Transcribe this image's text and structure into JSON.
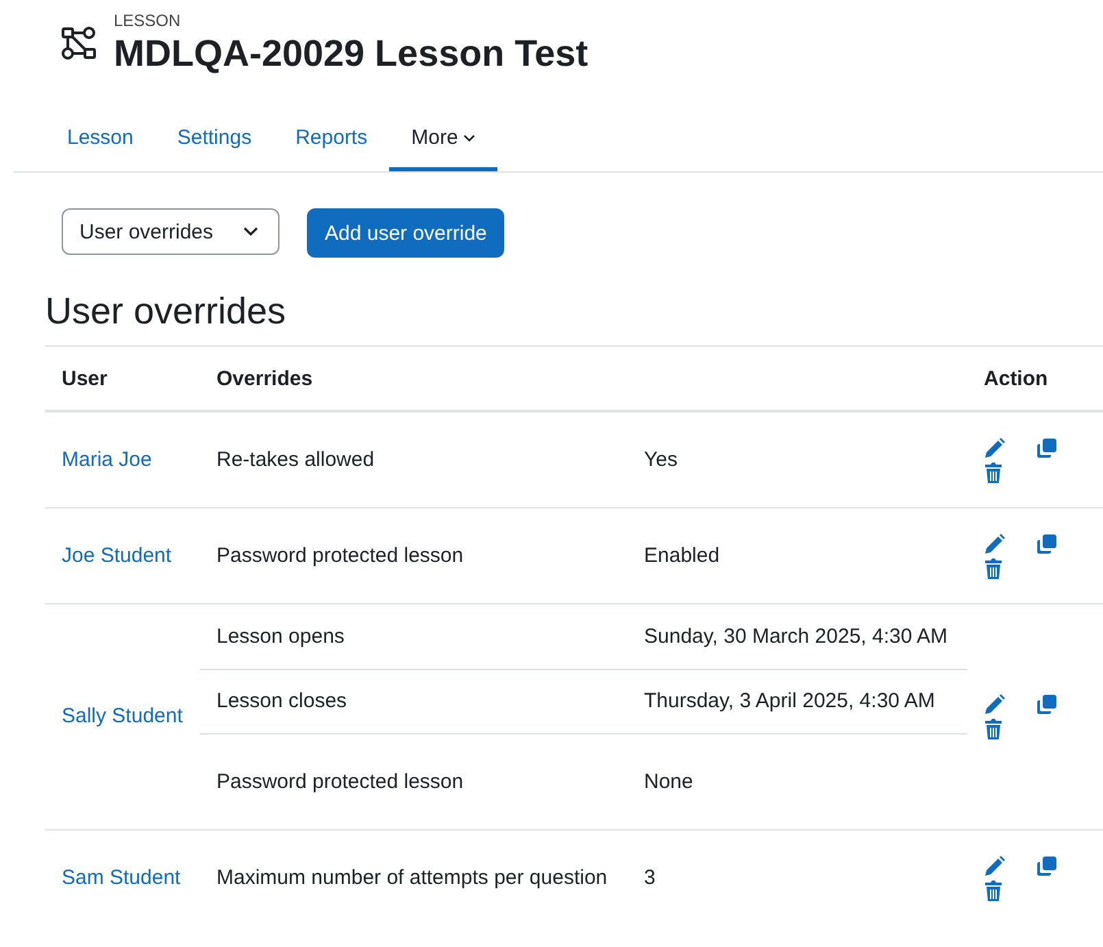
{
  "header": {
    "kicker": "LESSON",
    "title": "MDLQA-20029 Lesson Test"
  },
  "tabs": [
    {
      "label": "Lesson",
      "selected": false,
      "dropdown": false
    },
    {
      "label": "Settings",
      "selected": false,
      "dropdown": false
    },
    {
      "label": "Reports",
      "selected": false,
      "dropdown": false
    },
    {
      "label": "More",
      "selected": true,
      "dropdown": true
    }
  ],
  "select": {
    "value": "User overrides"
  },
  "add_button": "Add user override",
  "heading": "User overrides",
  "table": {
    "columns": [
      "User",
      "Overrides",
      "Action"
    ],
    "rows": [
      {
        "user": "Maria Joe",
        "overrides": [
          {
            "setting": "Re-takes allowed",
            "value": "Yes"
          }
        ]
      },
      {
        "user": "Joe Student",
        "overrides": [
          {
            "setting": "Password protected lesson",
            "value": "Enabled"
          }
        ]
      },
      {
        "user": "Sally Student",
        "overrides": [
          {
            "setting": "Lesson opens",
            "value": "Sunday, 30 March 2025, 4:30 AM"
          },
          {
            "setting": "Lesson closes",
            "value": "Thursday, 3 April 2025, 4:30 AM"
          },
          {
            "setting": "Password protected lesson",
            "value": "None"
          }
        ]
      },
      {
        "user": "Sam Student",
        "overrides": [
          {
            "setting": "Maximum number of attempts per question",
            "value": "3"
          }
        ]
      }
    ]
  }
}
